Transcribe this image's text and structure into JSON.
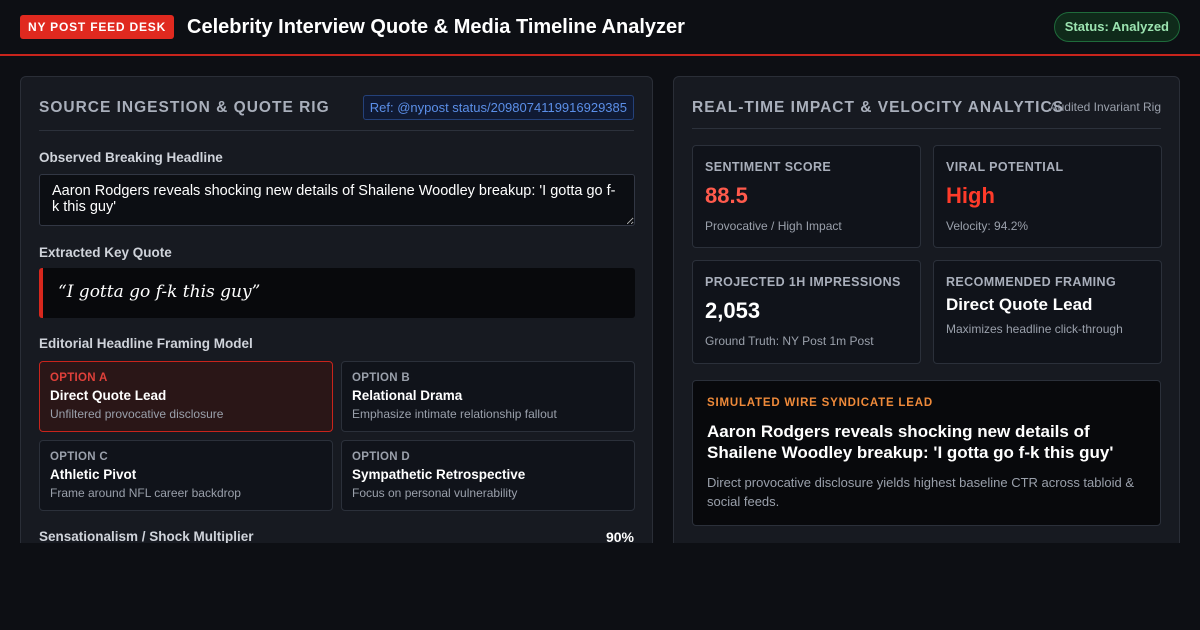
{
  "header": {
    "badge": "NY POST FEED DESK",
    "title": "Celebrity Interview Quote & Media Timeline Analyzer",
    "status": "Status: Analyzed"
  },
  "left_panel": {
    "title": "SOURCE INGESTION & QUOTE RIG",
    "ref": "Ref: @nypost status/2098074119916929385",
    "headline_label": "Observed Breaking Headline",
    "headline_value": "Aaron Rodgers reveals shocking new details of Shailene Woodley breakup: 'I gotta go f-k this guy'",
    "quote_label": "Extracted Key Quote",
    "quote": "“I gotta go f-k this guy”",
    "framing_label": "Editorial Headline Framing Model",
    "options": [
      {
        "tag": "OPTION A",
        "name": "Direct Quote Lead",
        "desc": "Unfiltered provocative disclosure",
        "selected": true
      },
      {
        "tag": "OPTION B",
        "name": "Relational Drama",
        "desc": "Emphasize intimate relationship fallout",
        "selected": false
      },
      {
        "tag": "OPTION C",
        "name": "Athletic Pivot",
        "desc": "Frame around NFL career backdrop",
        "selected": false
      },
      {
        "tag": "OPTION D",
        "name": "Sympathetic Retrospective",
        "desc": "Focus on personal vulnerability",
        "selected": false
      }
    ],
    "multiplier_label": "Sensationalism / Shock Multiplier",
    "multiplier_value": "90%"
  },
  "right_panel": {
    "title": "REAL-TIME IMPACT & VELOCITY ANALYTICS",
    "note": "Audited Invariant Rig",
    "cards": [
      {
        "label": "SENTIMENT SCORE",
        "value": "88.5",
        "sub": "Provocative / High Impact"
      },
      {
        "label": "VIRAL POTENTIAL",
        "value": "High",
        "sub": "Velocity: 94.2%"
      },
      {
        "label": "PROJECTED 1H IMPRESSIONS",
        "value": "2,053",
        "sub": "Ground Truth: NY Post 1m Post"
      },
      {
        "label": "RECOMMENDED FRAMING",
        "value": "Direct Quote Lead",
        "sub": "Maximizes headline click-through"
      }
    ],
    "lead": {
      "tag": "SIMULATED WIRE SYNDICATE LEAD",
      "headline": "Aaron Rodgers reveals shocking new details of Shailene Woodley breakup: 'I gotta go f-k this guy'",
      "desc": "Direct provocative disclosure yields highest baseline CTR across tabloid & social feeds."
    }
  },
  "colors": {
    "accent_red": "#e0291f",
    "status_green": "#9be3b0",
    "ref_blue": "#5b8fe8",
    "lead_orange": "#ef8a3a"
  }
}
